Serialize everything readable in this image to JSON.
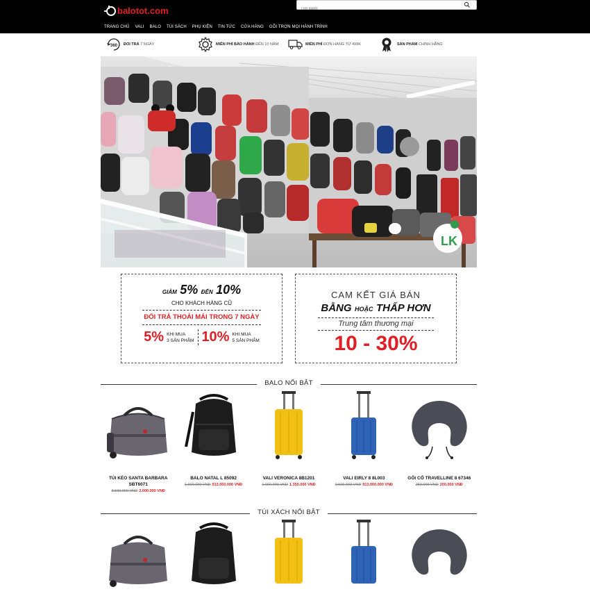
{
  "header": {
    "logo_text": "balotot.com",
    "search_placeholder": "Tìm kiếm",
    "nav": [
      "TRANG CHỦ",
      "VALI",
      "BALO",
      "TÚI SÁCH",
      "PHỤ KIỆN",
      "TIN TỨC",
      "CỬA HÀNG",
      "GỐI TRỢN MỌI HÀNH TRÌNH"
    ]
  },
  "benefits": [
    {
      "icon": "360-icon",
      "bold": "ĐỔI TRẢ",
      "light": "7 NGÀY"
    },
    {
      "icon": "gear-icon",
      "bold": "MIỄN PHÍ BẢO HÀNH",
      "light": "ĐẾN 10 NĂM"
    },
    {
      "icon": "truck-icon",
      "bold": "MIỄN PHÍ",
      "light": "ĐƠN HÀNG TỪ 499K"
    },
    {
      "icon": "award-icon",
      "bold": "SẢN PHẨM",
      "light": "CHÍNH HÃNG"
    }
  ],
  "promo1": {
    "line1_pre": "GIẢM",
    "line1_a": "5%",
    "line1_mid": "ĐẾN",
    "line1_b": "10%",
    "line2": "CHO KHÁCH HÀNG CŨ",
    "line3": "ĐỔI TRẢ THOẢI MÁI TRONG 7 NGÀY",
    "left_pct": "5%",
    "left_t1": "KHI MUA",
    "left_t2": "3 SẢN PHẨM",
    "right_pct": "10%",
    "right_t1": "KHI MUA",
    "right_t2": "5 SẢN PHẨM"
  },
  "promo2": {
    "line1": "CAM KẾT GIÁ BÁN",
    "line2_a": "BẰNG",
    "line2_b": "HOẶC",
    "line2_c": "THẤP HƠN",
    "line3": "Trung tâm thương mại",
    "line4": "10 - 30%"
  },
  "sections": [
    {
      "title": "BALO NỔI BẬT",
      "products": [
        {
          "name": "TÚI KÉO SANTA BARBARA SBT6071",
          "old": "3.500.000 VNĐ",
          "new": "2.000.000 VNĐ",
          "icon": "duffel-bag-icon"
        },
        {
          "name": "BALO NATAL L 85092",
          "old": "1.600.000 VNĐ",
          "new": "913.000.000 VNĐ",
          "icon": "backpack-icon"
        },
        {
          "name": "VALI VERONICA 8B1201",
          "old": "1.600.000 VNĐ",
          "new": "1.350.000 VNĐ",
          "icon": "yellow-suitcase-icon"
        },
        {
          "name": "VALI EIRLY 8 8L003",
          "old": "0.500.000 VNĐ",
          "new": "913.000.000 VNĐ",
          "icon": "blue-suitcase-icon"
        },
        {
          "name": "GỐI CỔ TRAVELLINE 8 67346",
          "old": "250.000 VNĐ",
          "new": "200.000 VNĐ",
          "icon": "neck-pillow-icon"
        }
      ]
    },
    {
      "title": "TÚI XÁCH NỔI BẬT",
      "products": [
        {
          "icon": "duffel-bag-icon"
        },
        {
          "icon": "backpack-icon"
        },
        {
          "icon": "yellow-suitcase-icon"
        },
        {
          "icon": "blue-suitcase-icon"
        },
        {
          "icon": "neck-pillow-icon"
        }
      ]
    }
  ],
  "colors": {
    "accent": "#e01e24",
    "header_bg": "#000000"
  }
}
